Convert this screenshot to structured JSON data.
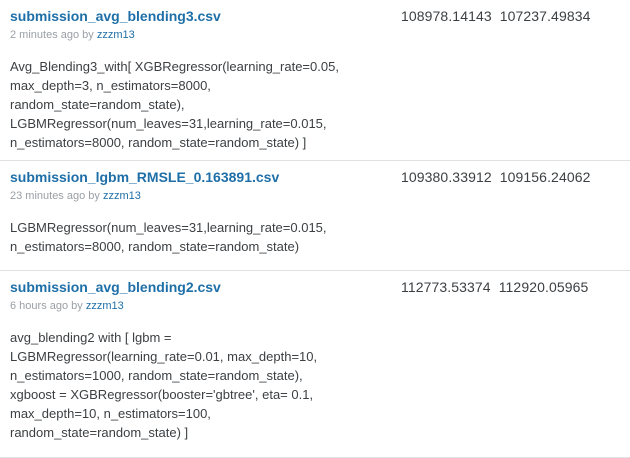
{
  "submissions": [
    {
      "filename": "submission_avg_blending3.csv",
      "time": "2 minutes ago by",
      "user": "zzzm13",
      "description": "Avg_Blending3_with[ XGBRegressor(learning_rate=0.05,\nmax_depth=3, n_estimators=8000,\nrandom_state=random_state),\nLGBMRegressor(num_leaves=31,learning_rate=0.015,\nn_estimators=8000, random_state=random_state) ]",
      "private_score": "108978.14143",
      "public_score": "107237.49834"
    },
    {
      "filename": "submission_lgbm_RMSLE_0.163891.csv",
      "time": "23 minutes ago by",
      "user": "zzzm13",
      "description": "LGBMRegressor(num_leaves=31,learning_rate=0.015,\nn_estimators=8000, random_state=random_state)",
      "private_score": "109380.33912",
      "public_score": "109156.24062"
    },
    {
      "filename": "submission_avg_blending2.csv",
      "time": "6 hours ago by",
      "user": "zzzm13",
      "description": "avg_blending2 with [ lgbm =\nLGBMRegressor(learning_rate=0.01, max_depth=10,\nn_estimators=1000, random_state=random_state),\nxgboost = XGBRegressor(booster='gbtree', eta= 0.1,\nmax_depth=10, n_estimators=100,\nrandom_state=random_state) ]",
      "private_score": "112773.53374",
      "public_score": "112920.05965"
    }
  ]
}
